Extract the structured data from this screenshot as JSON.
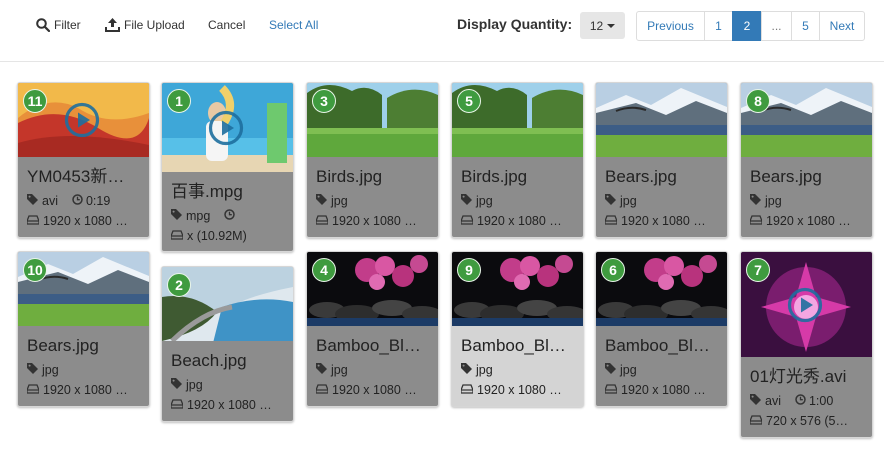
{
  "toolbar": {
    "filter_label": "Filter",
    "upload_label": "File Upload",
    "cancel_label": "Cancel",
    "select_all_label": "Select All",
    "display_quantity_label": "Display Quantity:",
    "display_quantity_value": "12"
  },
  "pagination": {
    "previous": "Previous",
    "pages": [
      "1",
      "2",
      "...",
      "5"
    ],
    "active_page": "2",
    "next": "Next"
  },
  "colors": {
    "accent": "#337ab7",
    "badge": "#3f9b3f",
    "card_bg": "#8c8c8c"
  },
  "cards": [
    {
      "number": "11",
      "title": "YM0453新…",
      "type": "avi",
      "duration": "0:19",
      "dimensions": "1920 x 1080 …",
      "thumb": "sunset",
      "video": true
    },
    {
      "number": "1",
      "title": "百事.mpg",
      "type": "mpg",
      "duration": "",
      "dimensions": "x (10.92M)",
      "thumb": "beach-girl",
      "video": true
    },
    {
      "number": "3",
      "title": "Birds.jpg",
      "type": "jpg",
      "duration": "",
      "dimensions": "1920 x 1080 …",
      "thumb": "park",
      "video": false
    },
    {
      "number": "5",
      "title": "Birds.jpg",
      "type": "jpg",
      "duration": "",
      "dimensions": "1920 x 1080 …",
      "thumb": "park",
      "video": false
    },
    {
      "number": "",
      "title": "Bears.jpg",
      "type": "jpg",
      "duration": "",
      "dimensions": "1920 x 1080 …",
      "thumb": "mountain",
      "video": false
    },
    {
      "number": "8",
      "title": "Bears.jpg",
      "type": "jpg",
      "duration": "",
      "dimensions": "1920 x 1080 …",
      "thumb": "mountain",
      "video": false
    },
    {
      "number": "10",
      "title": "Bears.jpg",
      "type": "jpg",
      "duration": "",
      "dimensions": "1920 x 1080 …",
      "thumb": "mountain",
      "video": false
    },
    {
      "number": "2",
      "title": "Beach.jpg",
      "type": "jpg",
      "duration": "",
      "dimensions": "1920 x 1080 …",
      "thumb": "coast",
      "video": false
    },
    {
      "number": "4",
      "title": "Bamboo_Bl…",
      "type": "jpg",
      "duration": "",
      "dimensions": "1920 x 1080 …",
      "thumb": "orchid",
      "video": false
    },
    {
      "number": "9",
      "title": "Bamboo_Bl…",
      "type": "jpg",
      "duration": "",
      "dimensions": "1920 x 1080 …",
      "thumb": "orchid",
      "video": false
    },
    {
      "number": "6",
      "title": "Bamboo_Bl…",
      "type": "jpg",
      "duration": "",
      "dimensions": "1920 x 1080 …",
      "thumb": "orchid",
      "video": false
    },
    {
      "number": "7",
      "title": "01灯光秀.avi",
      "type": "avi",
      "duration": "1:00",
      "dimensions": "720 x 576 (5…",
      "thumb": "lights",
      "video": true
    }
  ]
}
